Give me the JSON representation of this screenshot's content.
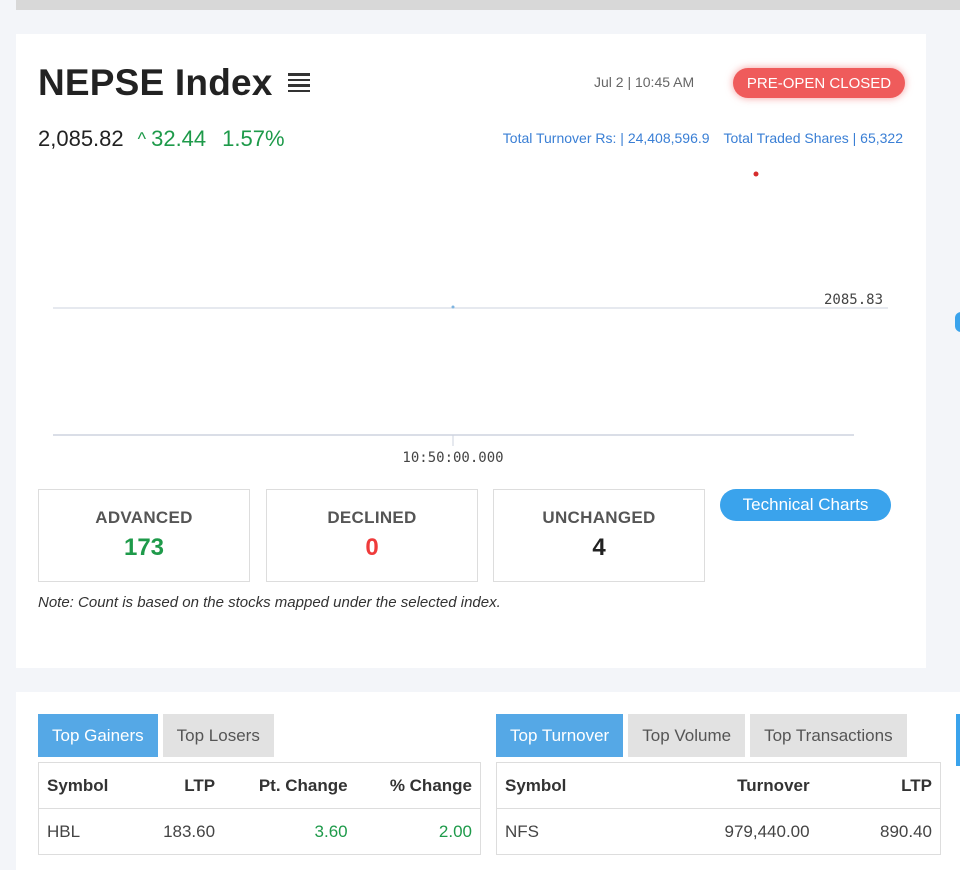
{
  "index": {
    "title": "NEPSE Index",
    "datetime": "Jul 2 | 10:45 AM",
    "status": "PRE-OPEN CLOSED",
    "value": "2,085.82",
    "change": "32.44",
    "percent": "1.57%",
    "turnover_label": "Total Turnover Rs: |",
    "turnover_value": "24,408,596.9",
    "shares_label": "Total Traded Shares |",
    "shares_value": "65,322"
  },
  "chart_data": {
    "type": "line",
    "x": [
      "10:50:00.000"
    ],
    "series": [
      {
        "values": [
          2085.83
        ]
      }
    ],
    "ylabel_value": "2085.83",
    "xtick": "10:50:00.000"
  },
  "breadth": {
    "advanced_label": "ADVANCED",
    "advanced": "173",
    "declined_label": "DECLINED",
    "declined": "0",
    "unchanged_label": "UNCHANGED",
    "unchanged": "4"
  },
  "technical_charts_label": "Technical Charts",
  "note": "Note: Count is based on the stocks mapped under the selected index.",
  "gainers_panel": {
    "tabs": [
      "Top Gainers",
      "Top Losers"
    ],
    "columns": [
      "Symbol",
      "LTP",
      "Pt. Change",
      "% Change"
    ],
    "rows": [
      [
        "HBL",
        "183.60",
        "3.60",
        "2.00"
      ]
    ]
  },
  "turnover_panel": {
    "tabs": [
      "Top Turnover",
      "Top Volume",
      "Top Transactions"
    ],
    "columns": [
      "Symbol",
      "Turnover",
      "LTP"
    ],
    "rows": [
      [
        "NFS",
        "979,440.00",
        "890.40"
      ]
    ]
  },
  "colors": {
    "positive": "#1e9a4a",
    "negative": "#ef3b3b",
    "accent": "#3aa3ec",
    "status": "#ef5b5b"
  }
}
